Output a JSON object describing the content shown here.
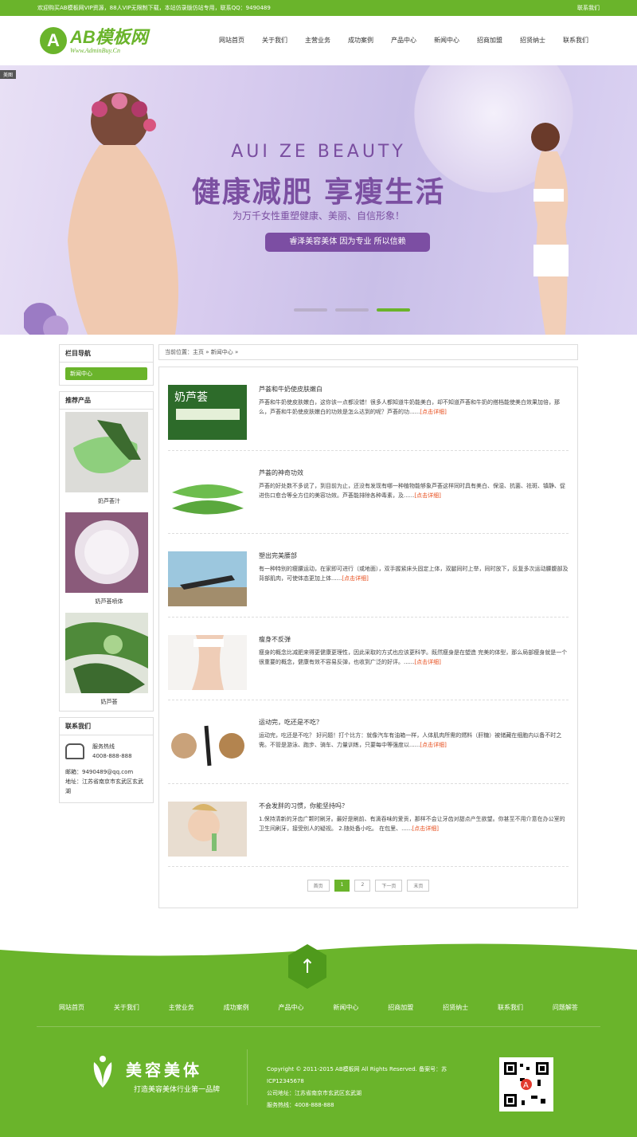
{
  "topbar": {
    "left": "欢迎购买AB模板网VIP资源，88人VIP无限制下载，本站仿录版仿站专用，联系QQ：9490489",
    "right": "联系我们"
  },
  "logo": {
    "mark": "A",
    "title": "AB模板网",
    "subtitle": "Www.AdminBuy.Cn"
  },
  "nav": [
    "网站首页",
    "关于我们",
    "主营业务",
    "成功案例",
    "产品中心",
    "新闻中心",
    "招商加盟",
    "招贤纳士",
    "联系我们"
  ],
  "banner": {
    "tag": "美图",
    "en": "AUI ZE BEAUTY",
    "title": "健康减肥 享瘦生活",
    "subtitle": "为万千女性重塑健康、美丽、自信形象！",
    "button": "睿泽美容美体 因为专业 所以信赖"
  },
  "sidebar": {
    "nav_title": "栏目导航",
    "nav_item": "新闻中心",
    "products_title": "推荐产品",
    "products": [
      {
        "name": "奶芦荟汁",
        "color": "#7fbf72"
      },
      {
        "name": "奶芦荟喷体",
        "color": "#c9b0cf"
      },
      {
        "name": "奶芦荟",
        "color": "#4f8a3a"
      }
    ],
    "contact_title": "联系我们",
    "hotline_label": "服务热线",
    "hotline": "4008-888-888",
    "email": "邮箱：9490489@qq.com",
    "address": "地址：江苏省南京市玄武区玄武湖"
  },
  "breadcrumb": "当前位置：主页 » 新闻中心 »",
  "news": [
    {
      "title": "芦荟和牛奶使皮肤嫩白",
      "desc": "芦荟和牛奶使皮肤嫩白，这你该一点都没错！很多人都知道牛奶能美白，却不知道芦荟和牛奶的搭档能使美白效果加倍，那么，芦荟和牛奶使皮肤嫩白的功效是怎么达到的呢？芦荟的功......",
      "more": "[点击详细]",
      "img": "#2d6b2a"
    },
    {
      "title": "芦荟的神奇功效",
      "desc": "芦荟的好处数不多说了，到目前为止，还没有发现有哪一种植物能够象芦荟这样同时具有美白、保湿、抗菌、祛斑、镇静、促进伤口愈合等全方位的美容功效。芦荟能排除各种毒素，及......",
      "more": "[点击详细]",
      "img": "#6dbd4e"
    },
    {
      "title": "塑出完美腰部",
      "desc": "有一种特别的瘦腰运动，在家即可进行（或地面），双手握紧床头固定上体，双腿同时上举，同时放下，反复多次运动腰腹部及背部肌肉，可使体态更加上体......",
      "more": "[点击详细]",
      "img": "#9cc7de"
    },
    {
      "title": "瘦身不反弹",
      "desc": "瘦身的概念比减肥来得更健康更理性，因此采取的方式也应该更科学。既然瘦身是在塑造 完美的体型，那么局部瘦身就是一个很重要的概念，健康有效不容易反弹，也收到广泛的好评。......",
      "more": "[点击详细]",
      "img": "#e9e5e1"
    },
    {
      "title": "运动完，吃还是不吃？",
      "desc": "运动完，吃还是不吃？ 好问题！打个比方：就像汽车有油箱一样，人体肌肉所需的燃料（肝糖）被储藏在细胞内以备不时之需。不管是游泳、跑步、骑车、力量训练，只要每中等强度以......",
      "more": "[点击详细]",
      "img": "#c9a27a"
    },
    {
      "title": "不会发胖的习惯，你能坚持吗？",
      "desc": "1.保持清新的牙齿广颗时刷牙。最好是刷前、有滴吞味的爱贡，那样不会让牙齿对甜点产生欲望。你甚至不用介意在办公室的卫生间刷牙，接受别人的疑视。 2.随处备小吃。 在包里、......",
      "more": "[点击详细]",
      "img": "#e8c8b0"
    }
  ],
  "pager": [
    "首页",
    "1",
    "2",
    "下一页",
    "末页"
  ],
  "footer": {
    "nav": [
      "网站首页",
      "关于我们",
      "主营业务",
      "成功案例",
      "产品中心",
      "新闻中心",
      "招商加盟",
      "招贤纳士",
      "联系我们",
      "问题解答"
    ],
    "brand": "美容美体",
    "slogan": "打造美容美体行业第一品牌",
    "copyright": "Copyright © 2011-2015 AB模板网 All Rights Reserved.  备案号：苏ICP12345678",
    "address": "公司地址：江苏省南京市玄武区玄武湖",
    "hotline": "服务热线：4008-888-888"
  }
}
